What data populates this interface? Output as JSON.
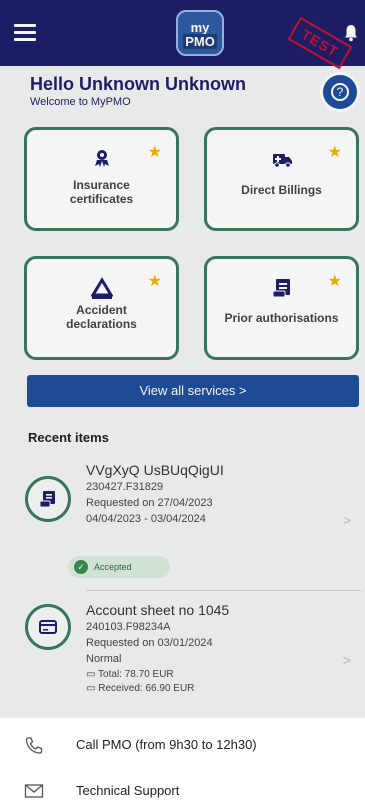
{
  "header": {
    "logo_line1": "my",
    "logo_line2": "PMO",
    "test_stamp": "TEST"
  },
  "greeting": {
    "title": "Hello Unknown Unknown",
    "subtitle": "Welcome to MyPMO",
    "help_glyph": "?"
  },
  "services": [
    {
      "label_line1": "Insurance",
      "label_line2": "certificates",
      "icon": "shield-person-icon"
    },
    {
      "label_line1": "Direct Billings",
      "label_line2": "",
      "icon": "ambulance-icon"
    },
    {
      "label_line1": "Accident",
      "label_line2": "declarations",
      "icon": "warning-icon"
    },
    {
      "label_line1": "Prior authorisations",
      "label_line2": "",
      "icon": "document-icon"
    }
  ],
  "view_all_label": "View all services  >",
  "recent_title": "Recent items",
  "recent_items": [
    {
      "title": "VVgXyQ UsBUqQigUI",
      "ref": "230427.F31829",
      "requested": "Requested on 27/04/2023",
      "period": "04/04/2023 - 03/04/2024",
      "status": "Accepted"
    },
    {
      "title": "Account sheet no 1045",
      "ref": "240103.F98234A",
      "requested": "Requested on 03/01/2024",
      "type": "Normal",
      "total": "Total: 78.70 EUR",
      "received": "Received: 66.90 EUR"
    }
  ],
  "bottom_sheet": {
    "call_label": "Call PMO (from 9h30 to 12h30)",
    "support_label": "Technical Support"
  },
  "colors": {
    "navy": "#1f1f6b",
    "primary_blue": "#1f4f9c",
    "tile_border_green": "#3b7a5d",
    "star_gold": "#f5b400",
    "accepted_green": "#3c8b4f"
  }
}
